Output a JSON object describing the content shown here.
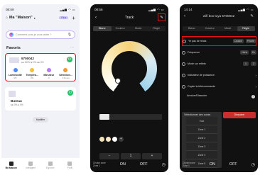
{
  "phone1": {
    "status": {
      "time": "08:59",
      "icons": "▂▄▆ ◠ ▭"
    },
    "header": {
      "title": "Ma \"Maison\"",
      "plus_badge": "Plus",
      "plus_icon": "+"
    },
    "ai_search": {
      "placeholder": "Comment puis-je vous aider ?"
    },
    "favorites": {
      "title": "Favoris",
      "more": "⋯"
    },
    "device1": {
      "name": "5700042",
      "sub": "●● 100% ● 0% ●● 0%",
      "quick": [
        {
          "label": "Luminosité",
          "value": "0%",
          "color": "#4a8cff"
        },
        {
          "label": "Tempéra...",
          "value": "0%",
          "color": "#f2c230"
        },
        {
          "label": "Minuteur",
          "value": "0",
          "color": "#b57bff"
        },
        {
          "label": "Sélection...",
          "value": "4 Zones",
          "color": "#f29a30"
        }
      ]
    },
    "device2": {
      "name": "Bureau",
      "sub": "●● 0% ● 0%"
    },
    "modifier": "Modifier",
    "tabs": [
      {
        "label": "Ma Maison",
        "active": true
      },
      {
        "label": "Intelligent",
        "active": false
      },
      {
        "label": "Explorer",
        "active": false
      },
      {
        "label": "Profil",
        "active": false
      }
    ]
  },
  "phone2": {
    "status": {
      "time": "08:56",
      "icons": "▂▄▆ ◠ ▭"
    },
    "title": "Track",
    "back": "‹",
    "edit_icon": "✎",
    "modes": [
      "Blanc",
      "Couleur",
      "Mode",
      "Règle"
    ],
    "selected_mode": 0,
    "brightness": {
      "label": "16%",
      "value": 16
    },
    "swatches": [
      "#f3e3b8",
      "#fbe8c6",
      "#ffffff"
    ],
    "stepper": {
      "minus": "−",
      "value": "1",
      "plus": "+"
    },
    "bottom": {
      "zone_label": "Choisir zone",
      "zone_value": "Zone 1",
      "on": "ON",
      "off": "OFF",
      "clock_icon": "◷"
    }
  },
  "phone3": {
    "status": {
      "time": "14:14",
      "icons": "▂▄▆ ◠ ▭"
    },
    "title": "wifi box tuya 5700042",
    "edit_icon": "✎",
    "modes": [
      "Blanc",
      "Couleur",
      "Mode",
      "Règle"
    ],
    "selected_mode": 3,
    "relais": {
      "label": "Ye pas de relais",
      "opt1": "Courant",
      "opt2": "Priorité"
    },
    "rows": [
      {
        "label": "Fréquence",
        "opt1": "Hertz",
        "opt2": "Ee"
      },
      {
        "label": "Mode sur reflets",
        "opt1": "1",
        "opt2": "2"
      },
      {
        "label": "Indicateur de puissance",
        "opt1": "",
        "opt2": ""
      },
      {
        "label": "Copier la télécommande",
        "opt1": "",
        "opt2": ""
      }
    ],
    "note": {
      "text": "Annuler/Dissocier",
      "q": "?"
    },
    "dropdown": {
      "header": "Sélectionner des zones",
      "items": [
        "Tout",
        "Zone 1",
        "Zone 2",
        "Zone 3",
        "Zone 4",
        "Zone 5"
      ]
    },
    "red_button": "Dissocier",
    "bottom": {
      "zone_label": "Choisir zone",
      "zone_value": "Zone 1",
      "on": "ON",
      "off": "OFF",
      "clock_icon": "◷"
    }
  }
}
